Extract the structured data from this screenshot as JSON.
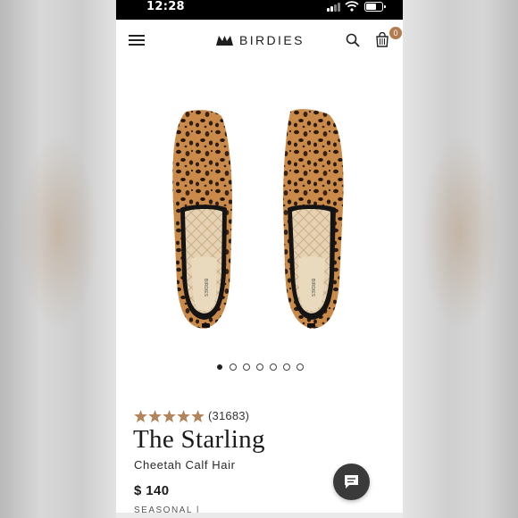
{
  "status_bar": {
    "time": "12:28"
  },
  "header": {
    "brand": "BIRDIES",
    "cart_count": "0",
    "icons": [
      "menu-icon",
      "search-icon",
      "cart-icon"
    ]
  },
  "gallery": {
    "image_alt": "Cheetah print loafers",
    "dot_count": 7,
    "active_index": 0
  },
  "product": {
    "rating": {
      "stars": 5,
      "count": "(31683)"
    },
    "name": "The Starling",
    "variant": "Cheetah Calf Hair",
    "price": "$ 140",
    "tag": "SEASONAL |"
  },
  "colors": {
    "accent": "#b37c4e",
    "star": "#b3845a",
    "text": "#1a1a1a",
    "chat_button": "#3a3a3a"
  }
}
